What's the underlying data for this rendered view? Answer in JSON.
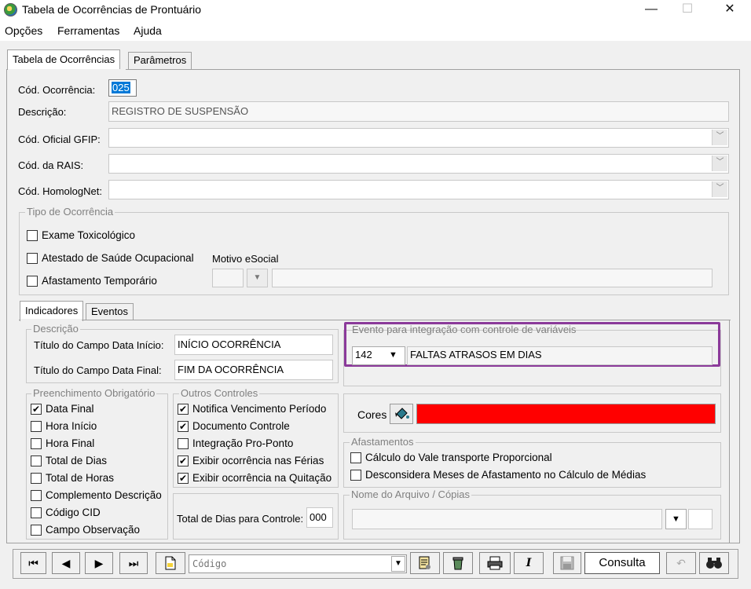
{
  "window": {
    "title": "Tabela de Ocorrências de Prontuário"
  },
  "menu": [
    "Opções",
    "Ferramentas",
    "Ajuda"
  ],
  "tabs": [
    "Tabela de Ocorrências",
    "Parâmetros"
  ],
  "form": {
    "cod_ocorrencia_label": "Cód. Ocorrência:",
    "cod_ocorrencia_value": "025",
    "descricao_label": "Descrição:",
    "descricao_value": "REGISTRO DE SUSPENSÃO",
    "gfip_label": "Cód. Oficial GFIP:",
    "rais_label": "Cód. da RAIS:",
    "homolognet_label": "Cód. HomologNet:"
  },
  "tipo": {
    "title": "Tipo de Ocorrência",
    "items": [
      "Exame Toxicológico",
      "Atestado de Saúde Ocupacional",
      "Afastamento Temporário"
    ],
    "motivo_label": "Motivo eSocial"
  },
  "subtabs": [
    "Indicadores",
    "Eventos"
  ],
  "descricao_group": {
    "title": "Descrição",
    "inicio_label": "Título do Campo Data Início:",
    "inicio_value": "INÍCIO OCORRÊNCIA",
    "final_label": "Título do Campo Data Final:",
    "final_value": "FIM DA OCORRÊNCIA"
  },
  "evento": {
    "title": "Evento para integração com controle de variáveis",
    "code": "142",
    "desc": "FALTAS ATRASOS EM DIAS"
  },
  "preenchimento": {
    "title": "Preenchimento Obrigatório",
    "items": [
      {
        "label": "Data Final",
        "checked": true
      },
      {
        "label": "Hora Início",
        "checked": false
      },
      {
        "label": "Hora Final",
        "checked": false
      },
      {
        "label": "Total de Dias",
        "checked": false
      },
      {
        "label": "Total de Horas",
        "checked": false
      },
      {
        "label": "Complemento Descrição",
        "checked": false
      },
      {
        "label": "Código CID",
        "checked": false
      },
      {
        "label": "Campo Observação",
        "checked": false
      }
    ]
  },
  "outros": {
    "title": "Outros Controles",
    "items": [
      {
        "label": "Notifica Vencimento Período",
        "checked": true
      },
      {
        "label": "Documento Controle",
        "checked": true
      },
      {
        "label": "Integração Pro-Ponto",
        "checked": false
      },
      {
        "label": "Exibir ocorrência nas Férias",
        "checked": true
      },
      {
        "label": "Exibir ocorrência na Quitação",
        "checked": true
      }
    ],
    "total_label": "Total de Dias para Controle:",
    "total_value": "000"
  },
  "cores": {
    "label": "Cores",
    "color": "#ff0000"
  },
  "afastamentos": {
    "title": "Afastamentos",
    "items": [
      {
        "label": "Cálculo do Vale transporte Proporcional",
        "checked": false
      },
      {
        "label": "Desconsidera Meses de Afastamento no Cálculo de Médias",
        "checked": false
      }
    ]
  },
  "arquivo": {
    "title": "Nome do Arquivo / Cópias"
  },
  "toolbar": {
    "search_placeholder": "Código",
    "consulta_label": "Consulta",
    "check_mark": "✔",
    "glyphs": {
      "first": "⏮",
      "prev": "◀",
      "next": "▶",
      "last": "⏭",
      "italic": "I",
      "dropdown": "▼",
      "minimize": "—",
      "maximize": "☐",
      "close": "✕"
    }
  },
  "colors": {
    "evento_highlight": "#8b3a9a",
    "accent": "#0078d7"
  }
}
